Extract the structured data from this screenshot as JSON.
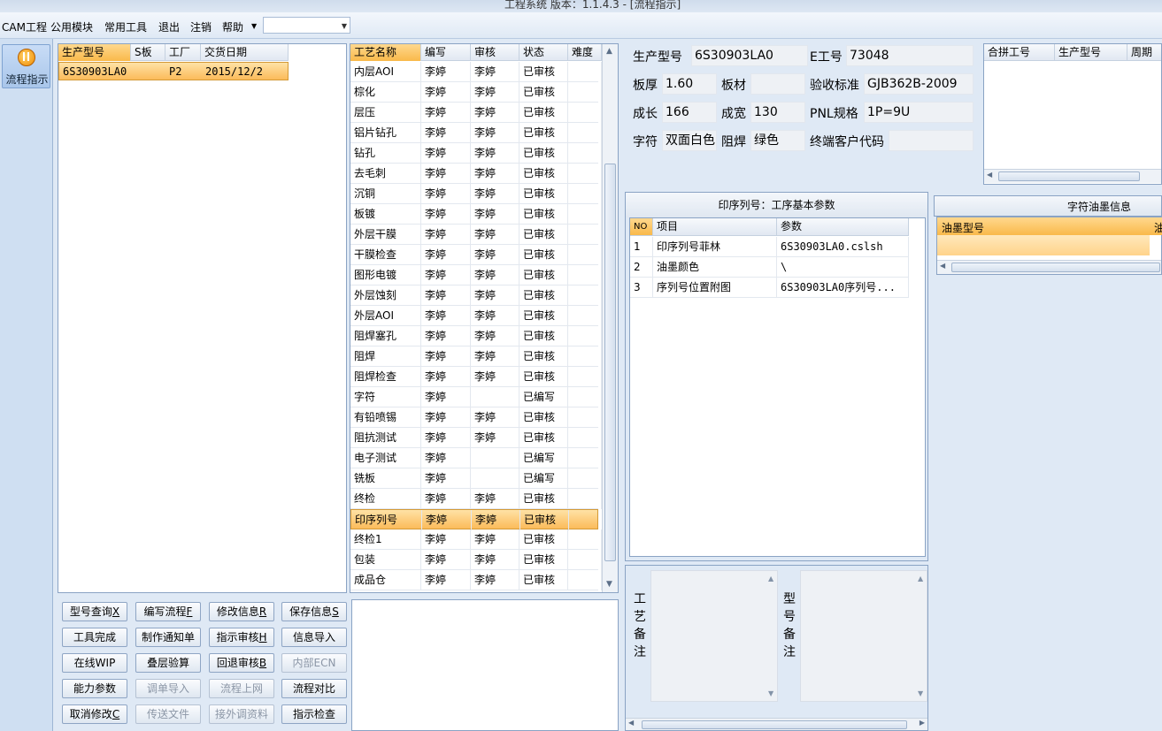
{
  "titlebar": "工程系统   版本：1.1.4.3 - [流程指示]",
  "menu": [
    "CAM工程",
    "公用模块",
    "常用工具",
    "退出",
    "注销",
    "帮助"
  ],
  "menu_combo_value": "",
  "nav": {
    "label": "流程指示"
  },
  "order_grid": {
    "headers": [
      "生产型号",
      "S板",
      "工厂",
      "交货日期"
    ],
    "rows": [
      {
        "model": "6S30903LA0",
        "s": "",
        "factory": "P2",
        "date": "2015/12/2"
      }
    ]
  },
  "process_grid": {
    "headers": [
      "工艺名称",
      "编写",
      "审核",
      "状态",
      "难度"
    ],
    "selected_index": 22,
    "rows": [
      [
        "内层AOI",
        "李婷",
        "李婷",
        "已审核"
      ],
      [
        "棕化",
        "李婷",
        "李婷",
        "已审核"
      ],
      [
        "层压",
        "李婷",
        "李婷",
        "已审核"
      ],
      [
        "铝片钻孔",
        "李婷",
        "李婷",
        "已审核"
      ],
      [
        "钻孔",
        "李婷",
        "李婷",
        "已审核"
      ],
      [
        "去毛刺",
        "李婷",
        "李婷",
        "已审核"
      ],
      [
        "沉铜",
        "李婷",
        "李婷",
        "已审核"
      ],
      [
        "板镀",
        "李婷",
        "李婷",
        "已审核"
      ],
      [
        "外层干膜",
        "李婷",
        "李婷",
        "已审核"
      ],
      [
        "干膜检查",
        "李婷",
        "李婷",
        "已审核"
      ],
      [
        "图形电镀",
        "李婷",
        "李婷",
        "已审核"
      ],
      [
        "外层蚀刻",
        "李婷",
        "李婷",
        "已审核"
      ],
      [
        "外层AOI",
        "李婷",
        "李婷",
        "已审核"
      ],
      [
        "阻焊塞孔",
        "李婷",
        "李婷",
        "已审核"
      ],
      [
        "阻焊",
        "李婷",
        "李婷",
        "已审核"
      ],
      [
        "阻焊检查",
        "李婷",
        "李婷",
        "已审核"
      ],
      [
        "字符",
        "李婷",
        "",
        "已编写"
      ],
      [
        "有铅喷锡",
        "李婷",
        "李婷",
        "已审核"
      ],
      [
        "阻抗测试",
        "李婷",
        "李婷",
        "已审核"
      ],
      [
        "电子测试",
        "李婷",
        "",
        "已编写"
      ],
      [
        "铣板",
        "李婷",
        "",
        "已编写"
      ],
      [
        "终检",
        "李婷",
        "李婷",
        "已审核"
      ],
      [
        "印序列号",
        "李婷",
        "李婷",
        "已审核"
      ],
      [
        "终检1",
        "李婷",
        "李婷",
        "已审核"
      ],
      [
        "包装",
        "李婷",
        "李婷",
        "已审核"
      ],
      [
        "成品仓",
        "李婷",
        "李婷",
        "已审核"
      ]
    ]
  },
  "buttons": [
    [
      {
        "text": "型号查询",
        "key": "X",
        "enabled": true
      },
      {
        "text": "编写流程",
        "key": "F",
        "enabled": true
      },
      {
        "text": "修改信息",
        "key": "R",
        "enabled": true
      },
      {
        "text": "保存信息",
        "key": "S",
        "enabled": true
      }
    ],
    [
      {
        "text": "工具完成",
        "key": "",
        "enabled": true
      },
      {
        "text": "制作通知单",
        "key": "",
        "enabled": true
      },
      {
        "text": "指示审核",
        "key": "H",
        "enabled": true
      },
      {
        "text": "信息导入",
        "key": "",
        "enabled": true
      }
    ],
    [
      {
        "text": "在线WIP",
        "key": "",
        "enabled": true
      },
      {
        "text": "叠层验算",
        "key": "",
        "enabled": true
      },
      {
        "text": "回退审核",
        "key": "B",
        "enabled": true
      },
      {
        "text": "内部ECN",
        "key": "",
        "enabled": false
      }
    ],
    [
      {
        "text": "能力参数",
        "key": "",
        "enabled": true
      },
      {
        "text": "调单导入",
        "key": "",
        "enabled": false
      },
      {
        "text": "流程上网",
        "key": "",
        "enabled": false
      },
      {
        "text": "流程对比",
        "key": "",
        "enabled": true
      }
    ],
    [
      {
        "text": "取消修改",
        "key": "C",
        "enabled": true
      },
      {
        "text": "传送文件",
        "key": "",
        "enabled": false
      },
      {
        "text": "接外调资料",
        "key": "",
        "enabled": false
      },
      {
        "text": "指示检查",
        "key": "",
        "enabled": true
      }
    ]
  ],
  "info": {
    "model_label": "生产型号",
    "model": "6S30903LA0",
    "e_label": "E工号",
    "e_no": "73048",
    "thick_label": "板厚",
    "thick": "1.60",
    "material_label": "板材",
    "material": "",
    "std_label": "验收标准",
    "std": "GJB362B-2009",
    "length_label": "成长",
    "length": "166",
    "width_label": "成宽",
    "width": "130",
    "pnl_label": "PNL规格",
    "pnl": "1P=9U",
    "char_label": "字符",
    "char": "双面白色",
    "mask_label": "阻焊",
    "mask": "绿色",
    "cust_label": "终端客户代码",
    "cust": ""
  },
  "merge_grid": {
    "headers": [
      "合拼工号",
      "生产型号",
      "周期"
    ]
  },
  "param_panel": {
    "title": "印序列号：工序基本参数",
    "headers": [
      "NO",
      "项目",
      "参数"
    ],
    "rows": [
      [
        "1",
        "印序列号菲林",
        "6S30903LA0.cslsh"
      ],
      [
        "2",
        "油墨颜色",
        "\\"
      ],
      [
        "3",
        "序列号位置附图",
        "6S30903LA0序列号..."
      ]
    ]
  },
  "ink_panel": {
    "title": "字符油墨信息",
    "headers": [
      "油墨型号",
      "油"
    ]
  },
  "remarks": {
    "process_label": "工艺备注",
    "model_label": "型号备注",
    "process_text": "",
    "model_text": ""
  }
}
